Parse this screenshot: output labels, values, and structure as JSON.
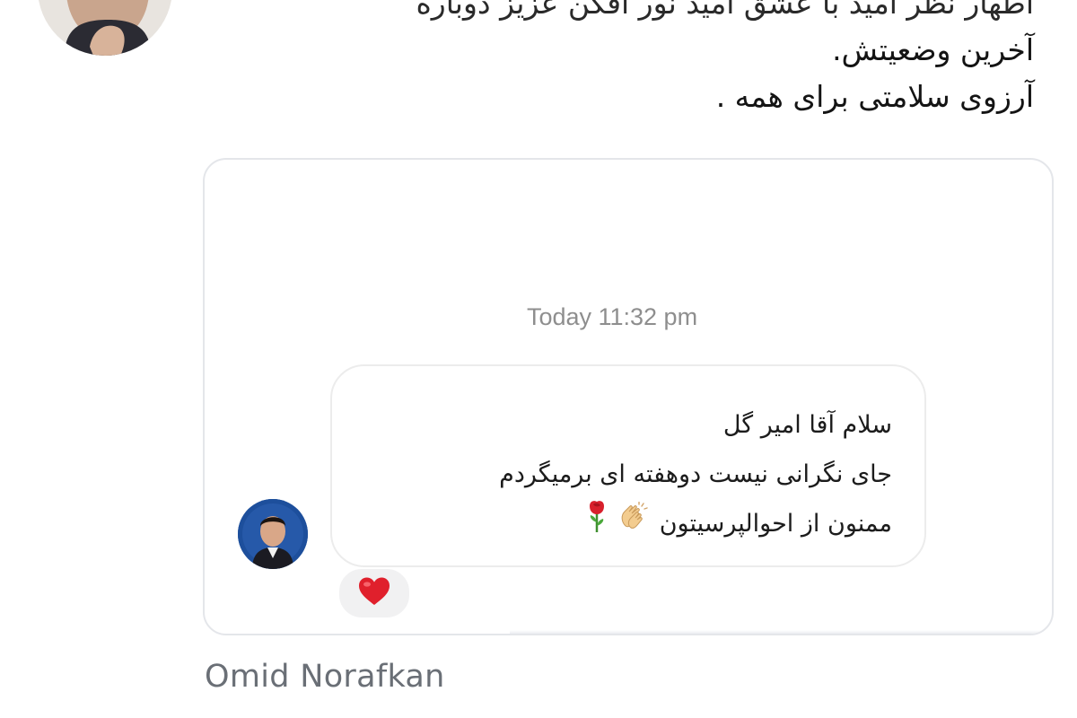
{
  "tweet": {
    "lines": [
      "اطهار نظر امید با عشق امید نور افکن عزیز دوباره",
      "آخرین وضعیتش.",
      "آرزوی سلامتی برای همه ."
    ],
    "avatar_icon": "person-portrait-icon"
  },
  "dm_card": {
    "timestamp": "Today 11:32 pm",
    "message": {
      "lines": [
        "سلام آقا امیر گل",
        "جای نگرانی نیست دوهفته ای برمیگردم",
        "ممنون از احوالپرسیتون"
      ],
      "trailing_emojis": [
        "clapping-hands-icon",
        "rose-icon"
      ]
    },
    "sender_avatar_icon": "person-portrait-icon",
    "reaction": {
      "icon": "heart-icon",
      "color": "#e0202c"
    }
  },
  "footer": {
    "name": "Omid Norafkan"
  },
  "colors": {
    "timestamp": "#8e8e8e",
    "footer_name": "#6a6f76",
    "card_border": "#e4e6ea",
    "heart": "#e0202c",
    "sender_avatar_bg": "#1e4f9a"
  }
}
